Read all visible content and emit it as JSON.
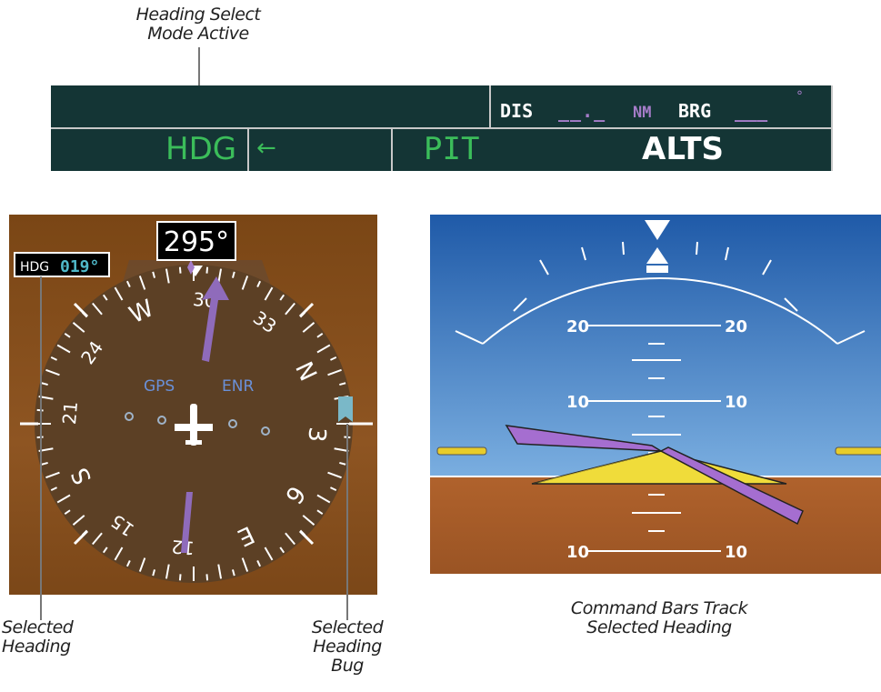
{
  "callouts": {
    "top": [
      "Heading Select",
      "Mode Active"
    ],
    "selected_heading": [
      "Selected",
      "Heading"
    ],
    "heading_bug": [
      "Selected",
      "Heading",
      "Bug"
    ],
    "command_bars": [
      "Command Bars Track",
      "Selected Heading"
    ]
  },
  "status_bar": {
    "lateral_mode": "HDG",
    "arrow": "←",
    "vertical_mode": "PIT",
    "armed_mode": "ALTS",
    "dis_label": "DIS",
    "dis_value": "__._",
    "dis_unit": "NM",
    "brg_label": "BRG",
    "brg_value": "___",
    "brg_unit": "°"
  },
  "hsi": {
    "heading_readout": "295°",
    "selected_heading_label": "HDG",
    "selected_heading_value": "019°",
    "nav_source": "GPS",
    "flight_phase": "ENR",
    "compass_labels": [
      "S",
      "21",
      "24",
      "W",
      "30",
      "33",
      "N",
      "3",
      "6",
      "E",
      "12",
      "15"
    ]
  },
  "adi": {
    "pitch_labels": [
      "20",
      "20",
      "10",
      "10",
      "10",
      "10"
    ]
  },
  "colors": {
    "green": "#3bbd5a",
    "magenta": "#a57cc8",
    "cyan": "#4fb8c8",
    "sky": "#2b6cc0",
    "ground": "#a95f2c"
  }
}
